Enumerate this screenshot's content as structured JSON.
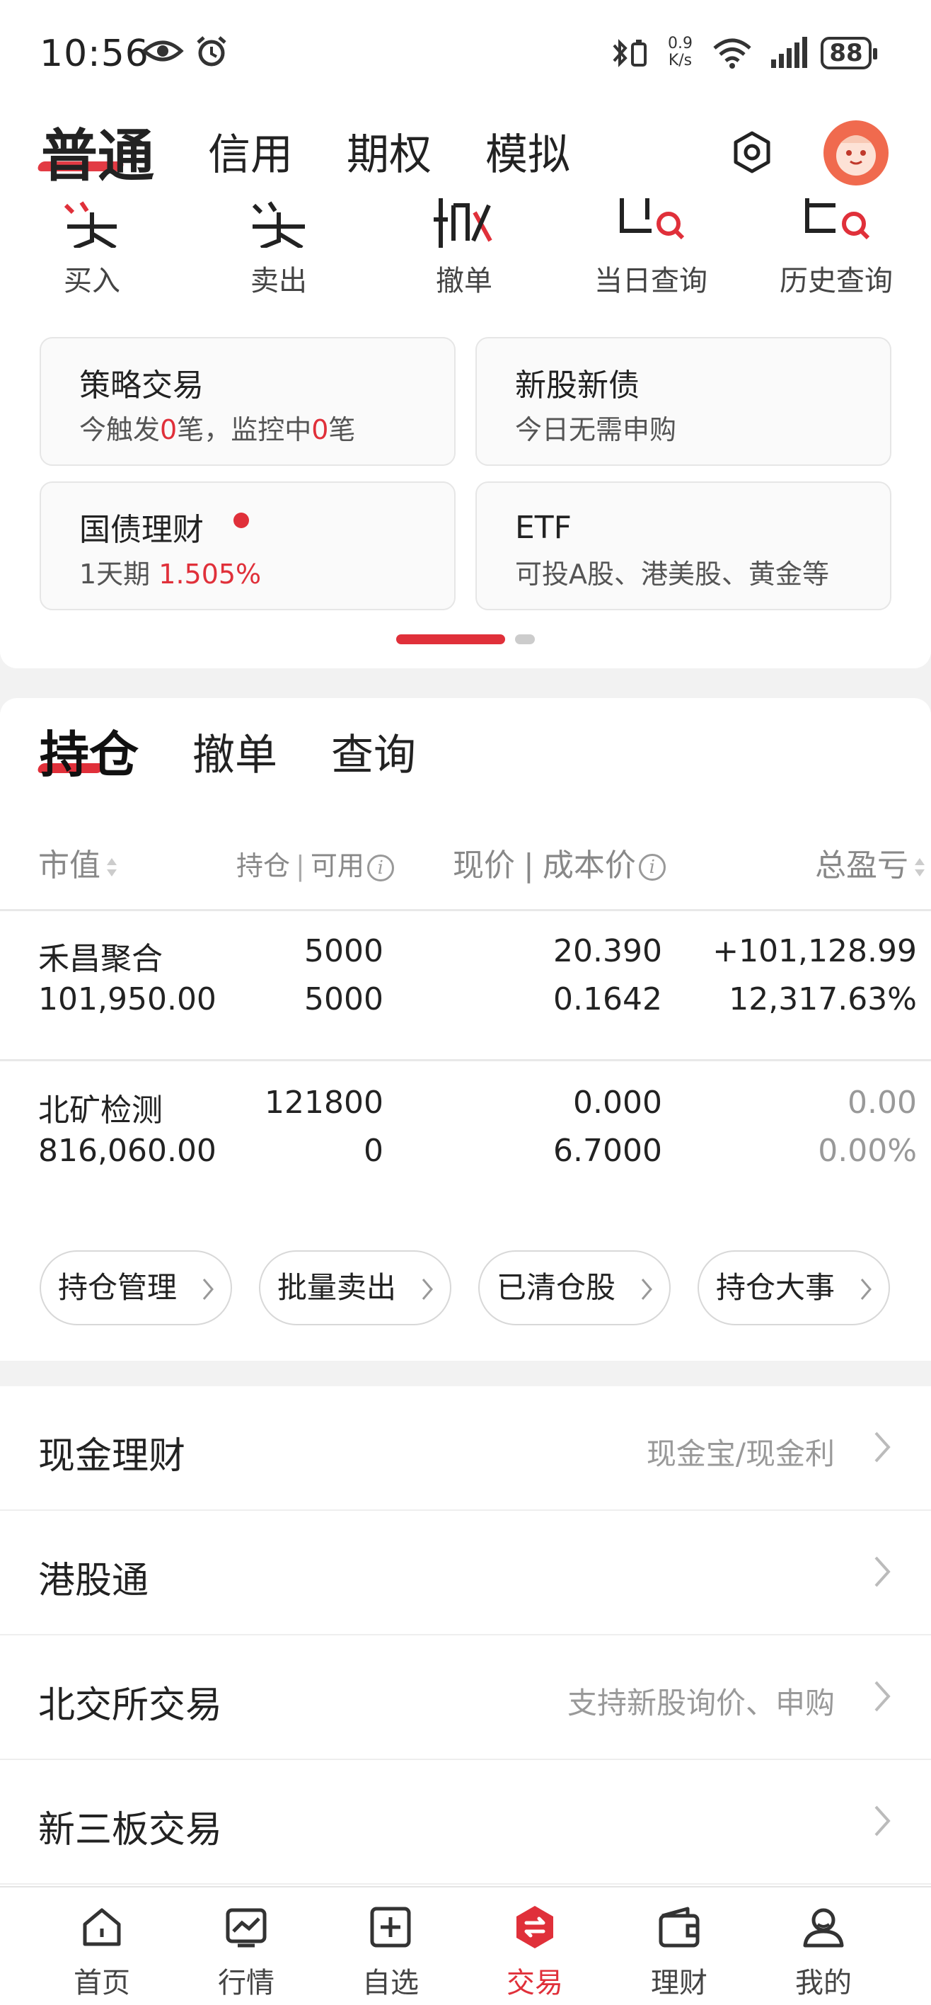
{
  "status_bar": {
    "time": "10:56",
    "net_speed_value": "0.9",
    "net_speed_unit": "K/s",
    "battery": "88"
  },
  "header": {
    "tabs": [
      "普通",
      "信用",
      "期权",
      "模拟"
    ],
    "active_tab": "普通"
  },
  "quick_actions": [
    {
      "label": "买入",
      "icon": "buy-icon"
    },
    {
      "label": "卖出",
      "icon": "sell-icon"
    },
    {
      "label": "撤单",
      "icon": "cancel-order-icon"
    },
    {
      "label": "当日查询",
      "icon": "today-query-icon"
    },
    {
      "label": "历史查询",
      "icon": "history-query-icon"
    }
  ],
  "cards": {
    "strategy": {
      "title": "策略交易",
      "sub_prefix": "今触发",
      "triggered": "0",
      "sub_mid": "笔，监控中",
      "monitoring": "0",
      "sub_suffix": "笔"
    },
    "ipo": {
      "title": "新股新债",
      "sub": "今日无需申购"
    },
    "bond": {
      "title": "国债理财",
      "sub_prefix": "1天期 ",
      "rate": "1.505%"
    },
    "etf": {
      "title": "ETF",
      "sub": "可投A股、港美股、黄金等"
    }
  },
  "positions": {
    "tabs": [
      "持仓",
      "撤单",
      "查询"
    ],
    "columns": {
      "market_value": "市值",
      "holding": "持仓",
      "available": "可用",
      "price": "现价",
      "cost": "成本价",
      "pnl": "总盈亏"
    },
    "rows": [
      {
        "name": "禾昌聚合",
        "market_value": "101,950.00",
        "holding": "5000",
        "available": "5000",
        "price": "20.390",
        "cost": "0.1642",
        "pnl": "+101,128.99",
        "pnl_pct": "12,317.63%",
        "status": "up"
      },
      {
        "name": "北矿检测",
        "market_value": "816,060.00",
        "holding": "121800",
        "available": "0",
        "price": "0.000",
        "cost": "6.7000",
        "pnl": "0.00",
        "pnl_pct": "0.00%",
        "status": "flat"
      }
    ],
    "actions": [
      "持仓管理",
      "批量卖出",
      "已清仓股",
      "持仓大事"
    ]
  },
  "list": [
    {
      "title": "现金理财",
      "right": "现金宝/现金利"
    },
    {
      "title": "港股通",
      "right": ""
    },
    {
      "title": "北交所交易",
      "right": "支持新股询价、申购"
    },
    {
      "title": "新三板交易",
      "right": ""
    }
  ],
  "bottom_nav": [
    {
      "label": "首页",
      "icon": "home-icon"
    },
    {
      "label": "行情",
      "icon": "market-icon"
    },
    {
      "label": "自选",
      "icon": "watchlist-icon"
    },
    {
      "label": "交易",
      "icon": "trade-icon"
    },
    {
      "label": "理财",
      "icon": "wallet-icon"
    },
    {
      "label": "我的",
      "icon": "profile-icon"
    }
  ],
  "colors": {
    "accent": "#e0303a",
    "muted": "#888888"
  }
}
